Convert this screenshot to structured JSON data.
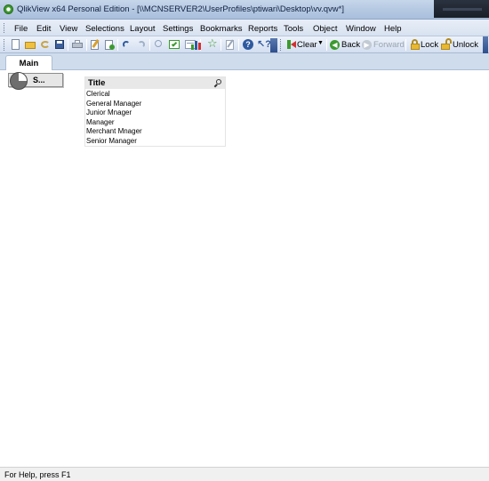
{
  "window": {
    "title": "QlikView x64 Personal Edition - [\\\\MCNSERVER2\\UserProfiles\\ptiwari\\Desktop\\vv.qvw*]"
  },
  "menu": [
    "File",
    "Edit",
    "View",
    "Selections",
    "Layout",
    "Settings",
    "Bookmarks",
    "Reports",
    "Tools",
    "Object",
    "Window",
    "Help"
  ],
  "toolbar": {
    "clear_label": "Clear",
    "back_label": "Back",
    "forward_label": "Forward",
    "lock_label": "Lock",
    "unlock_label": "Unlock"
  },
  "tabs": [
    {
      "label": "Main",
      "active": true
    }
  ],
  "minimized_object": {
    "label": "S..."
  },
  "listbox": {
    "title": "Title",
    "values": [
      "Clerical",
      "General Manager",
      "Junior Mnager",
      "Manager",
      "Merchant Mnager",
      "Senior Manager"
    ]
  },
  "status": {
    "text": "For Help, press F1"
  },
  "colors": {
    "title_bar": "#b4c8e2",
    "menu_bar": "#dce5f2",
    "tab_row": "#cfdcec",
    "listbox_caption": "#e8e8e8",
    "accent_green": "#3c9a2f"
  }
}
